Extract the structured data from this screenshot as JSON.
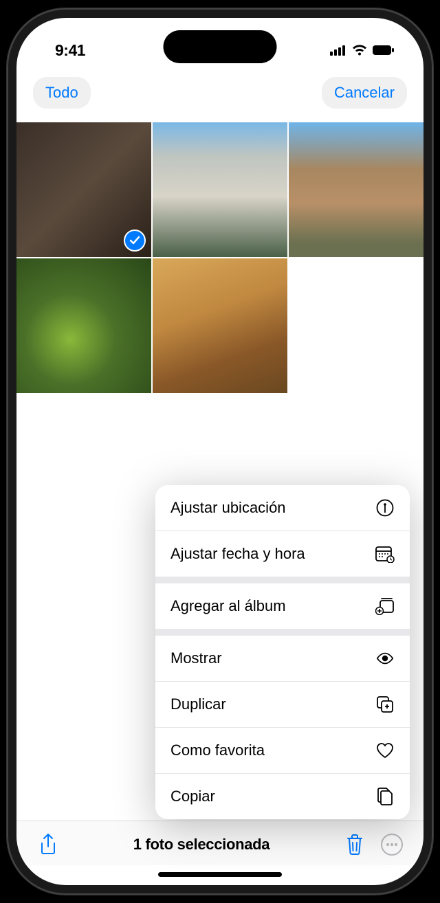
{
  "status_bar": {
    "time": "9:41"
  },
  "nav": {
    "left_button": "Todo",
    "right_button": "Cancelar"
  },
  "photos": [
    {
      "selected": true
    },
    {
      "selected": false
    },
    {
      "selected": false
    },
    {
      "selected": false
    },
    {
      "selected": false
    }
  ],
  "menu": {
    "groups": [
      [
        {
          "label": "Ajustar ubicación",
          "icon": "info-circle"
        },
        {
          "label": "Ajustar fecha y hora",
          "icon": "calendar"
        }
      ],
      [
        {
          "label": "Agregar al álbum",
          "icon": "album-add"
        }
      ],
      [
        {
          "label": "Mostrar",
          "icon": "eye"
        },
        {
          "label": "Duplicar",
          "icon": "duplicate"
        },
        {
          "label": "Como favorita",
          "icon": "heart"
        },
        {
          "label": "Copiar",
          "icon": "copy-docs"
        }
      ]
    ]
  },
  "toolbar": {
    "status_text": "1 foto seleccionada"
  }
}
